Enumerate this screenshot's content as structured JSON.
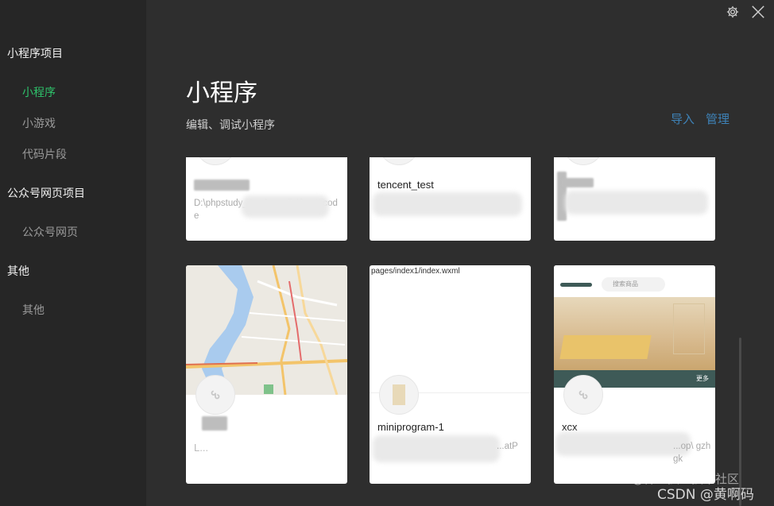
{
  "sidebar": {
    "sections": [
      {
        "title": "小程序项目",
        "items": [
          "小程序",
          "小游戏",
          "代码片段"
        ]
      },
      {
        "title": "公众号网页项目",
        "items": [
          "公众号网页"
        ]
      },
      {
        "title": "其他",
        "items": [
          "其他"
        ]
      }
    ],
    "active_item": "小程序"
  },
  "header": {
    "title": "小程序",
    "subtitle": "编辑、调试小程序",
    "import_label": "导入",
    "manage_label": "管理"
  },
  "cards": [
    {
      "name": "",
      "path": "D:\\phpstudy_...ush angjia\\front_code"
    },
    {
      "name": "tencent_test",
      "path": ""
    },
    {
      "name": "",
      "path": ""
    },
    {
      "name": "L...",
      "path": "",
      "preview": "map"
    },
    {
      "name": "miniprogram-1",
      "path": "...atP",
      "preview_path": "pages/index1/index.wxml"
    },
    {
      "name": "xcx",
      "path": "...op\\ gzhgk",
      "preview": "shop",
      "preview_search": "搜索商品",
      "preview_more": "更多"
    }
  ],
  "watermark": {
    "line1": "@稀土掘金技术社区",
    "line2": "CSDN @黄啊码"
  },
  "colors": {
    "accent": "#2ec36b",
    "link": "#3e82b7",
    "sidebar_bg": "#262626",
    "main_bg": "#2e2e2e"
  },
  "icons": [
    "gear-icon",
    "close-icon",
    "mini-program-icon"
  ]
}
